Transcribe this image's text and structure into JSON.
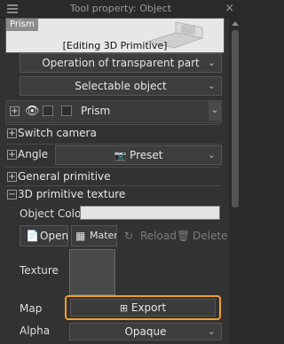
{
  "window": {
    "title": "Tool property: Object",
    "close_glyph": "×"
  },
  "preview": {
    "tag": "Prism",
    "editing_label": "[Editing 3D Primitive]"
  },
  "dropdowns": {
    "transparent_op": "Operation of transparent part",
    "selectable": "Selectable object"
  },
  "layer": {
    "name": "Prism"
  },
  "sections": {
    "switch_camera": "Switch camera",
    "angle": "Angle",
    "angle_preset": "Preset",
    "general_primitive": "General primitive",
    "texture": "3D primitive texture"
  },
  "texture": {
    "object_color_label": "Object Color",
    "object_color": "#e4e4e4",
    "open": "Open",
    "material": "Materia",
    "reload": "Reload",
    "delete": "Delete",
    "texture_label": "Texture",
    "map_label": "Map",
    "export": "Export",
    "alpha_label": "Alpha",
    "alpha_value": "Opaque"
  },
  "colors": {
    "highlight": "#f0a028"
  }
}
